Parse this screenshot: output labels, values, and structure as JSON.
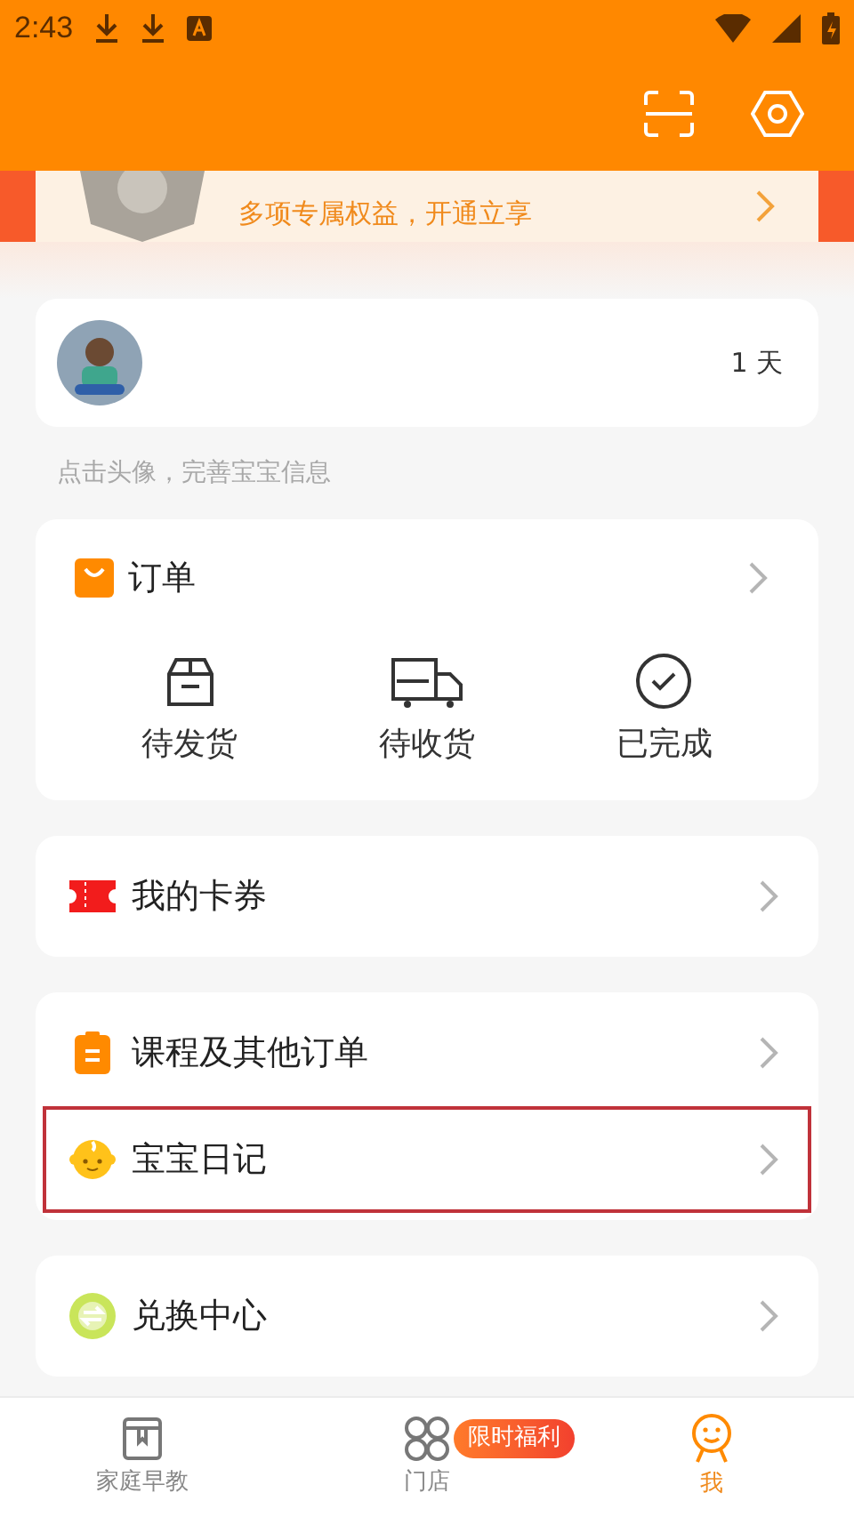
{
  "status_bar": {
    "time": "2:43"
  },
  "banner": {
    "text": "多项专属权益，开通立享"
  },
  "profile": {
    "days": "1 天",
    "hint": "点击头像，完善宝宝信息"
  },
  "orders": {
    "title": "订单",
    "actions": [
      "待发货",
      "待收货",
      "已完成"
    ]
  },
  "menu_groups": [
    {
      "items": [
        {
          "label": "我的卡券",
          "highlighted": false
        }
      ]
    },
    {
      "items": [
        {
          "label": "课程及其他订单",
          "highlighted": false
        },
        {
          "label": "宝宝日记",
          "highlighted": true
        }
      ]
    },
    {
      "items": [
        {
          "label": "兑换中心",
          "highlighted": false
        }
      ]
    }
  ],
  "bottom_nav": [
    {
      "label": "家庭早教",
      "selected": false
    },
    {
      "label": "门店",
      "selected": false,
      "badge": "限时福利"
    },
    {
      "label": "我",
      "selected": true
    }
  ]
}
